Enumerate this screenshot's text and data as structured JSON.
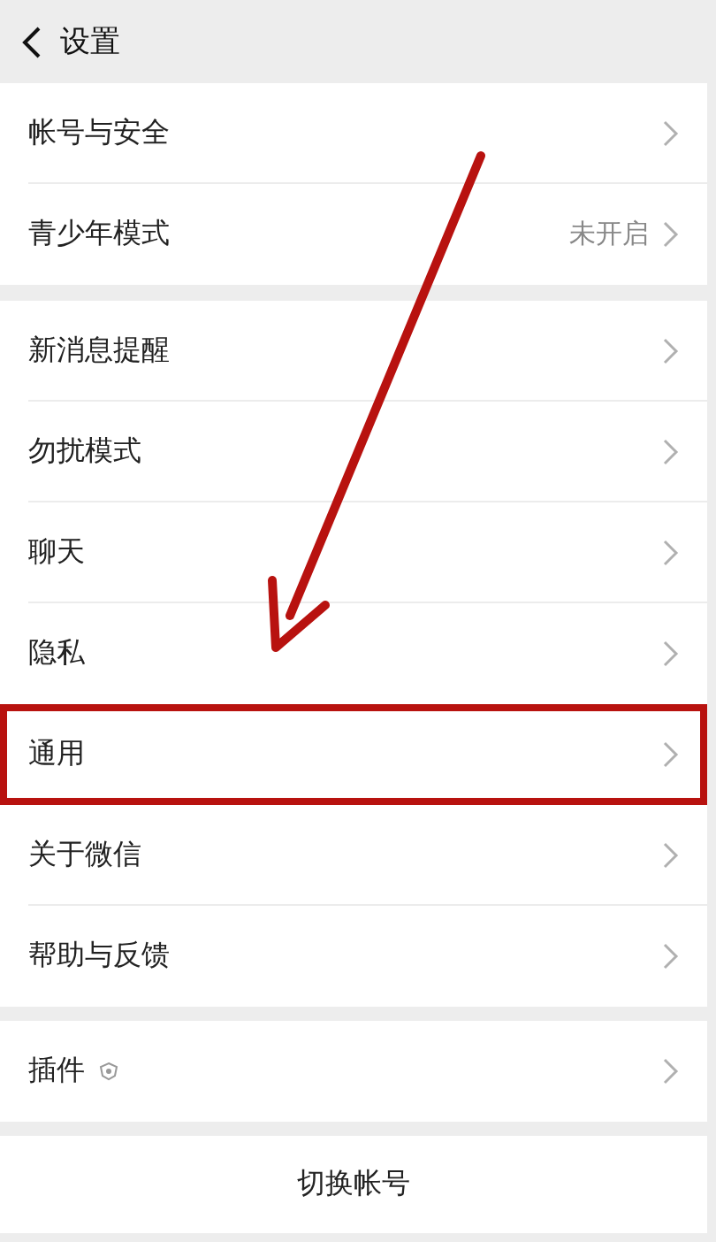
{
  "header": {
    "title": "设置"
  },
  "groups": [
    {
      "items": [
        {
          "label": "帐号与安全",
          "value": null,
          "badge": false,
          "highlighted": false
        },
        {
          "label": "青少年模式",
          "value": "未开启",
          "badge": false,
          "highlighted": false
        }
      ]
    },
    {
      "items": [
        {
          "label": "新消息提醒",
          "value": null,
          "badge": false,
          "highlighted": false
        },
        {
          "label": "勿扰模式",
          "value": null,
          "badge": false,
          "highlighted": false
        },
        {
          "label": "聊天",
          "value": null,
          "badge": false,
          "highlighted": false
        },
        {
          "label": "隐私",
          "value": null,
          "badge": false,
          "highlighted": false
        },
        {
          "label": "通用",
          "value": null,
          "badge": false,
          "highlighted": true
        },
        {
          "label": "关于微信",
          "value": null,
          "badge": false,
          "highlighted": false
        },
        {
          "label": "帮助与反馈",
          "value": null,
          "badge": false,
          "highlighted": false
        }
      ]
    },
    {
      "items": [
        {
          "label": "插件",
          "value": null,
          "badge": true,
          "highlighted": false
        }
      ]
    }
  ],
  "switch_account": "切换帐号"
}
